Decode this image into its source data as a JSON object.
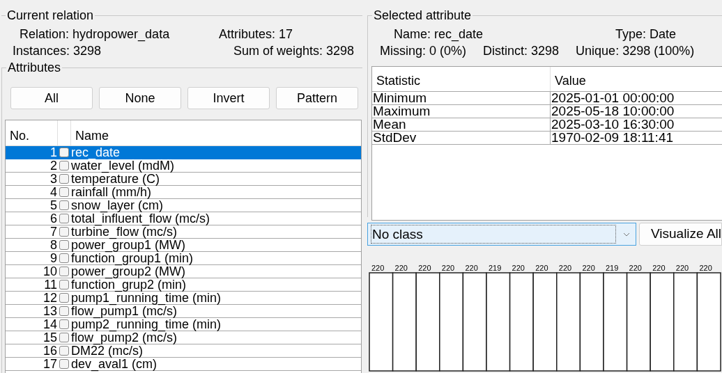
{
  "current_relation": {
    "title": "Current relation",
    "relation": "Relation: hydropower_data",
    "attributes_count": "Attributes: 17",
    "instances": "Instances: 3298",
    "sum_of_weights": "Sum of weights: 3298"
  },
  "attributes": {
    "title": "Attributes",
    "buttons": [
      "All",
      "None",
      "Invert",
      "Pattern"
    ],
    "columns": [
      "No.",
      "Name"
    ],
    "rows": [
      {
        "no": "1",
        "name": "rec_date",
        "checked": false,
        "selected": true
      },
      {
        "no": "2",
        "name": "water_level (mdM)",
        "checked": false,
        "selected": false
      },
      {
        "no": "3",
        "name": "temperature (C)",
        "checked": false,
        "selected": false
      },
      {
        "no": "4",
        "name": "rainfall (mm/h)",
        "checked": false,
        "selected": false
      },
      {
        "no": "5",
        "name": "snow_layer (cm)",
        "checked": false,
        "selected": false
      },
      {
        "no": "6",
        "name": "total_influent_flow (mc/s)",
        "checked": false,
        "selected": false
      },
      {
        "no": "7",
        "name": "turbine_flow (mc/s)",
        "checked": false,
        "selected": false
      },
      {
        "no": "8",
        "name": "power_group1 (MW)",
        "checked": false,
        "selected": false
      },
      {
        "no": "9",
        "name": "function_group1 (min)",
        "checked": false,
        "selected": false
      },
      {
        "no": "10",
        "name": "power_group2 (MW)",
        "checked": false,
        "selected": false
      },
      {
        "no": "11",
        "name": "function_grup2 (min)",
        "checked": false,
        "selected": false
      },
      {
        "no": "12",
        "name": "pump1_running_time (min)",
        "checked": false,
        "selected": false
      },
      {
        "no": "13",
        "name": "flow_pump1 (mc/s)",
        "checked": false,
        "selected": false
      },
      {
        "no": "14",
        "name": "pump2_running_time (min)",
        "checked": false,
        "selected": false
      },
      {
        "no": "15",
        "name": "flow_pump2 (mc/s)",
        "checked": false,
        "selected": false
      },
      {
        "no": "16",
        "name": "DM22 (mc/s)",
        "checked": false,
        "selected": false
      },
      {
        "no": "17",
        "name": "dev_aval1 (cm)",
        "checked": false,
        "selected": false
      }
    ]
  },
  "selected_attribute": {
    "title": "Selected attribute",
    "name": "Name: rec_date",
    "type": "Type: Date",
    "missing": "Missing: 0 (0%)",
    "distinct": "Distinct: 3298",
    "unique": "Unique: 3298 (100%)",
    "columns": [
      "Statistic",
      "Value"
    ],
    "rows": [
      {
        "statistic": "Minimum",
        "value": "2025-01-01 00:00:00"
      },
      {
        "statistic": "Maximum",
        "value": "2025-05-18 10:00:00"
      },
      {
        "statistic": "Mean",
        "value": "2025-03-10 16:30:00"
      },
      {
        "statistic": "StdDev",
        "value": "1970-02-09 18:11:41"
      }
    ]
  },
  "class_select": {
    "value": "No class"
  },
  "visualize_button": "Visualize All",
  "histogram": {
    "bar_labels": [
      "220",
      "220",
      "220",
      "220",
      "220",
      "219",
      "220",
      "220",
      "220",
      "220",
      "219",
      "220",
      "220",
      "220",
      "220"
    ]
  }
}
